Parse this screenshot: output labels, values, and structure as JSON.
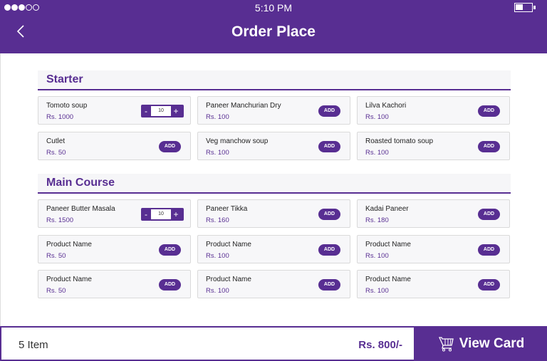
{
  "status_bar": {
    "time": "5:10 PM",
    "signal_bars_filled": 3,
    "signal_bars_total": 5
  },
  "header": {
    "title": "Order Place",
    "back_icon": "chevron-left-icon"
  },
  "sections": [
    {
      "title": "Starter",
      "items": [
        {
          "name": "Tomoto soup",
          "price": "Rs. 1000",
          "quantity": "10",
          "control": "stepper"
        },
        {
          "name": "Paneer Manchurian Dry",
          "price": "Rs. 100",
          "control": "add"
        },
        {
          "name": "Lilva Kachori",
          "price": "Rs. 100",
          "control": "add"
        },
        {
          "name": "Cutlet",
          "price": "Rs. 50",
          "control": "add"
        },
        {
          "name": "Veg manchow soup",
          "price": "Rs. 100",
          "control": "add"
        },
        {
          "name": "Roasted tomato soup",
          "price": "Rs. 100",
          "control": "add"
        }
      ]
    },
    {
      "title": "Main Course",
      "items": [
        {
          "name": "Paneer Butter Masala",
          "price": "Rs. 1500",
          "quantity": "10",
          "control": "stepper"
        },
        {
          "name": "Paneer Tikka",
          "price": "Rs. 160",
          "control": "add"
        },
        {
          "name": "Kadai Paneer",
          "price": "Rs. 180",
          "control": "add"
        },
        {
          "name": "Product Name",
          "price": "Rs. 50",
          "control": "add"
        },
        {
          "name": "Product Name",
          "price": "Rs. 100",
          "control": "add"
        },
        {
          "name": "Product Name",
          "price": "Rs. 100",
          "control": "add"
        },
        {
          "name": "Product Name",
          "price": "Rs. 50",
          "control": "add"
        },
        {
          "name": "Product Name",
          "price": "Rs. 100",
          "control": "add"
        },
        {
          "name": "Product Name",
          "price": "Rs. 100",
          "control": "add"
        }
      ]
    }
  ],
  "labels": {
    "add": "ADD",
    "minus": "-",
    "plus": "+"
  },
  "footer": {
    "item_count": "5 Item",
    "total": "Rs. 800/-",
    "view_card_label": "View Card",
    "cart_icon": "cart-icon"
  },
  "colors": {
    "brand": "#582e92"
  }
}
